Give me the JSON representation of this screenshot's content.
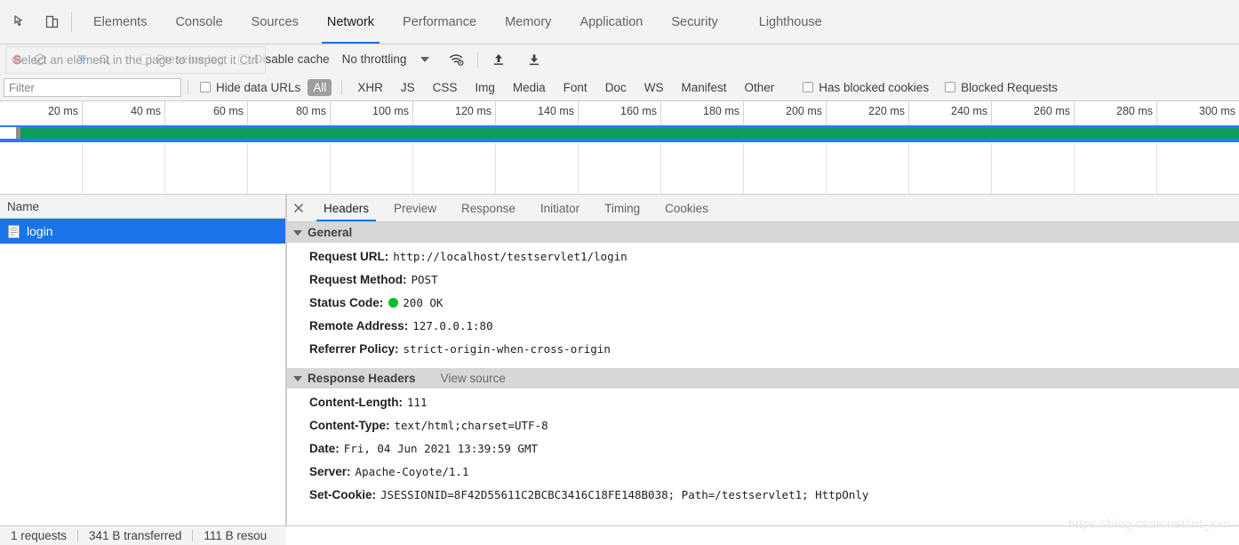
{
  "tabbar": {
    "inspect_icon": "inspect-cursor-icon",
    "device_icon": "device-toolbar-icon",
    "tabs": [
      {
        "label": "Elements",
        "active": false
      },
      {
        "label": "Console",
        "active": false
      },
      {
        "label": "Sources",
        "active": false
      },
      {
        "label": "Network",
        "active": true
      },
      {
        "label": "Performance",
        "active": false
      },
      {
        "label": "Memory",
        "active": false
      },
      {
        "label": "Application",
        "active": false
      },
      {
        "label": "Security",
        "active": false
      },
      {
        "label": "Lighthouse",
        "active": false
      }
    ]
  },
  "toolbar": {
    "record_icon": "record-stop-icon",
    "clear_icon": "clear-no-entry-icon",
    "filter_icon": "filter-funnel-icon",
    "search_icon": "search-magnifier-icon",
    "preserve_log_label": "Preserve log",
    "disable_cache_label": "Disable cache",
    "throttling_value": "No throttling",
    "throttle_caret_icon": "chevron-down-icon",
    "wifi_icon": "network-conditions-wifi-icon",
    "upload_icon": "import-har-arrow-up-icon",
    "download_icon": "export-har-arrow-down-icon",
    "tooltip_text": "Select an element in the page to inspect it  Ctrl"
  },
  "filterbar": {
    "filter_placeholder": "Filter",
    "filter_value": "",
    "hide_data_urls_label": "Hide data URLs",
    "types": [
      {
        "label": "All",
        "selected": true
      },
      {
        "label": "XHR",
        "selected": false
      },
      {
        "label": "JS",
        "selected": false
      },
      {
        "label": "CSS",
        "selected": false
      },
      {
        "label": "Img",
        "selected": false
      },
      {
        "label": "Media",
        "selected": false
      },
      {
        "label": "Font",
        "selected": false
      },
      {
        "label": "Doc",
        "selected": false
      },
      {
        "label": "WS",
        "selected": false
      },
      {
        "label": "Manifest",
        "selected": false
      },
      {
        "label": "Other",
        "selected": false
      }
    ],
    "has_blocked_cookies_label": "Has blocked cookies",
    "blocked_requests_label": "Blocked Requests"
  },
  "overview": {
    "ticks": [
      "20 ms",
      "40 ms",
      "60 ms",
      "80 ms",
      "100 ms",
      "120 ms",
      "140 ms",
      "160 ms",
      "180 ms",
      "200 ms",
      "220 ms",
      "240 ms",
      "260 ms",
      "280 ms",
      "300 ms"
    ],
    "colors": {
      "band_blue": "#2979ff",
      "band_green": "#0f9d58",
      "band_gray": "#8e8e8e"
    }
  },
  "requests": {
    "column_header": "Name",
    "rows": [
      {
        "name": "login",
        "icon": "document-file-icon",
        "selected": true
      }
    ]
  },
  "details": {
    "close_icon": "close-x-icon",
    "tabs": [
      {
        "label": "Headers",
        "active": true
      },
      {
        "label": "Preview",
        "active": false
      },
      {
        "label": "Response",
        "active": false
      },
      {
        "label": "Initiator",
        "active": false
      },
      {
        "label": "Timing",
        "active": false
      },
      {
        "label": "Cookies",
        "active": false
      }
    ],
    "general": {
      "title": "General",
      "rows": [
        {
          "key": "Request URL:",
          "value": "http://localhost/testservlet1/login"
        },
        {
          "key": "Request Method:",
          "value": "POST"
        },
        {
          "key": "Status Code:",
          "value": "200 OK",
          "status_dot": "#0bbf28"
        },
        {
          "key": "Remote Address:",
          "value": "127.0.0.1:80"
        },
        {
          "key": "Referrer Policy:",
          "value": "strict-origin-when-cross-origin"
        }
      ]
    },
    "response_headers": {
      "title": "Response Headers",
      "view_source": "View source",
      "rows": [
        {
          "key": "Content-Length:",
          "value": "111"
        },
        {
          "key": "Content-Type:",
          "value": "text/html;charset=UTF-8"
        },
        {
          "key": "Date:",
          "value": "Fri, 04 Jun 2021 13:39:59 GMT"
        },
        {
          "key": "Server:",
          "value": "Apache-Coyote/1.1"
        },
        {
          "key": "Set-Cookie:",
          "value": "JSESSIONID=8F42D55611C2BCBC3416C18FE148B038; Path=/testservlet1; HttpOnly"
        }
      ]
    }
  },
  "statusbar": {
    "requests": "1 requests",
    "transferred": "341 B transferred",
    "resources": "111 B resou"
  },
  "watermark": "https://blog.csdn.net/int_xxn"
}
